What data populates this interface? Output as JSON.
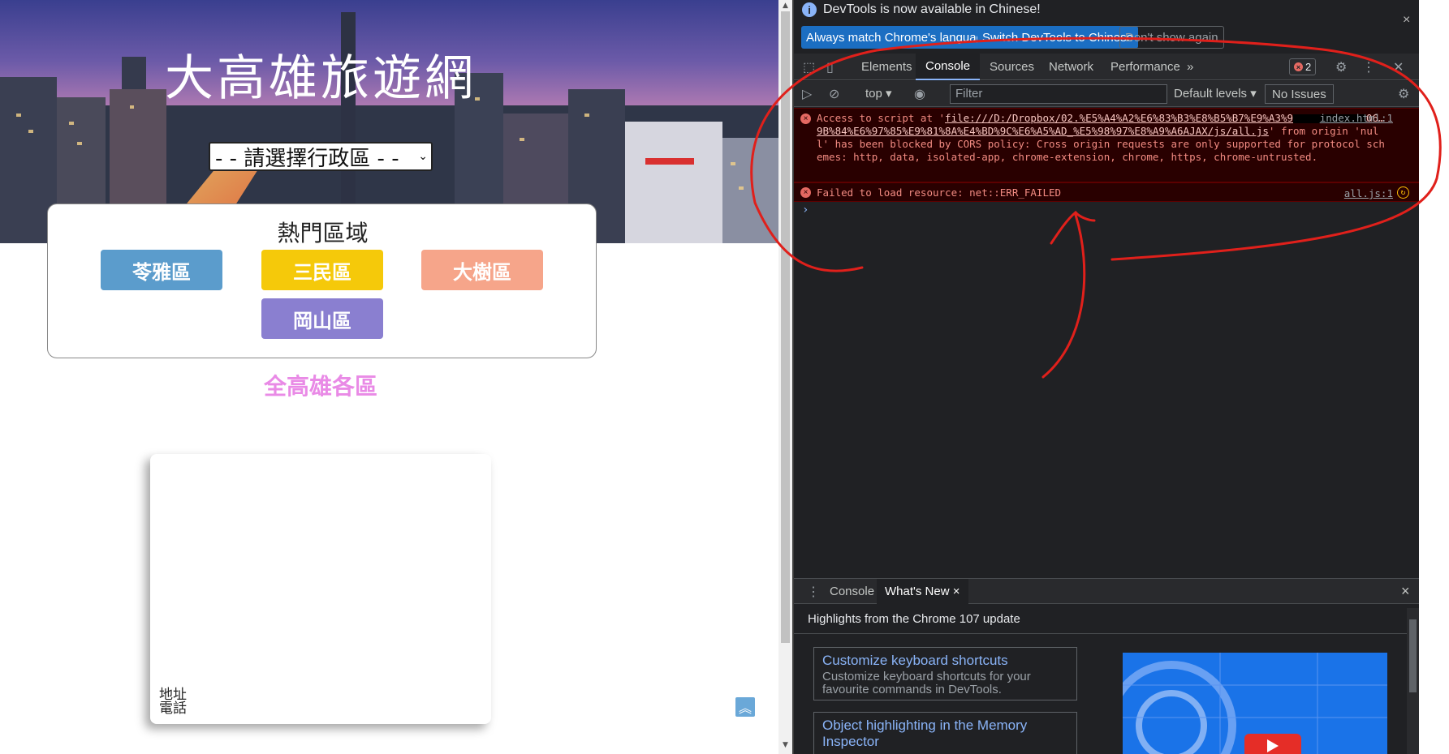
{
  "page": {
    "hero_title": "大高雄旅遊網",
    "district_select": "- - 請選擇行政區 - -",
    "hot_title": "熱門區域",
    "hot_buttons": [
      {
        "label": "苓雅區",
        "color": "#5b9ccc"
      },
      {
        "label": "三民區",
        "color": "#f5c90a"
      },
      {
        "label": "大樹區",
        "color": "#f6a58a"
      },
      {
        "label": "岡山區",
        "color": "#8a7fd0"
      }
    ],
    "all_title": "全高雄各區",
    "card_address": "地址",
    "card_phone": "電話",
    "gotop_icon": "double-chevron-up-icon"
  },
  "devtools": {
    "infobar": {
      "message": "DevTools is now available in Chinese!",
      "btn_match": "Always match Chrome's language",
      "btn_switch": "Switch DevTools to Chinese",
      "btn_dont": "Don't show again",
      "close": "×"
    },
    "tabs": [
      "Elements",
      "Console",
      "Sources",
      "Network",
      "Performance"
    ],
    "active_tab": "Console",
    "more": "»",
    "error_count": "2",
    "toolbar": {
      "context": "top",
      "filter_placeholder": "Filter",
      "levels": "Default levels",
      "issues": "No Issues"
    },
    "messages": [
      {
        "text_pre": "Access to script at '",
        "url_part1": "file:///D:/Dropbox/02.%E5%A4%A2%E6%83%B3%E8%B5%B7%E9%A3%9",
        "url_part2": "06…9B%84%E6%97%85%E9%81%8A%E4%BD%9C%E6%A5%AD_%E5%98%97%E8%A9%A6AJAX/js/all.js",
        "text_post": "' from origin 'null' has been blocked by CORS policy: Cross origin requests are only supported for protocol schemes: http, data, isolated-app, chrome-extension, chrome, https, chrome-untrusted.",
        "source": "index.html:1"
      },
      {
        "text": "Failed to load resource: net::ERR_FAILED",
        "source": "all.js:1"
      }
    ],
    "prompt": "›",
    "drawer": {
      "tab_console": "Console",
      "tab_whatsnew": "What's New",
      "tab_close": "×",
      "close": "×",
      "highlights": "Highlights from the Chrome 107 update",
      "cards": [
        {
          "title": "Customize keyboard shortcuts",
          "desc": "Customize keyboard shortcuts for your favourite commands in DevTools."
        },
        {
          "title": "Object highlighting in the Memory",
          "desc": "Inspector"
        }
      ]
    }
  },
  "colors": {
    "annotation_red": "#e0201b",
    "devtools_bg": "#202124",
    "error_bg": "#290000",
    "error_text": "#f28b82",
    "link_blue": "#8ab4f8",
    "all_title_pink": "#e98ae6"
  }
}
